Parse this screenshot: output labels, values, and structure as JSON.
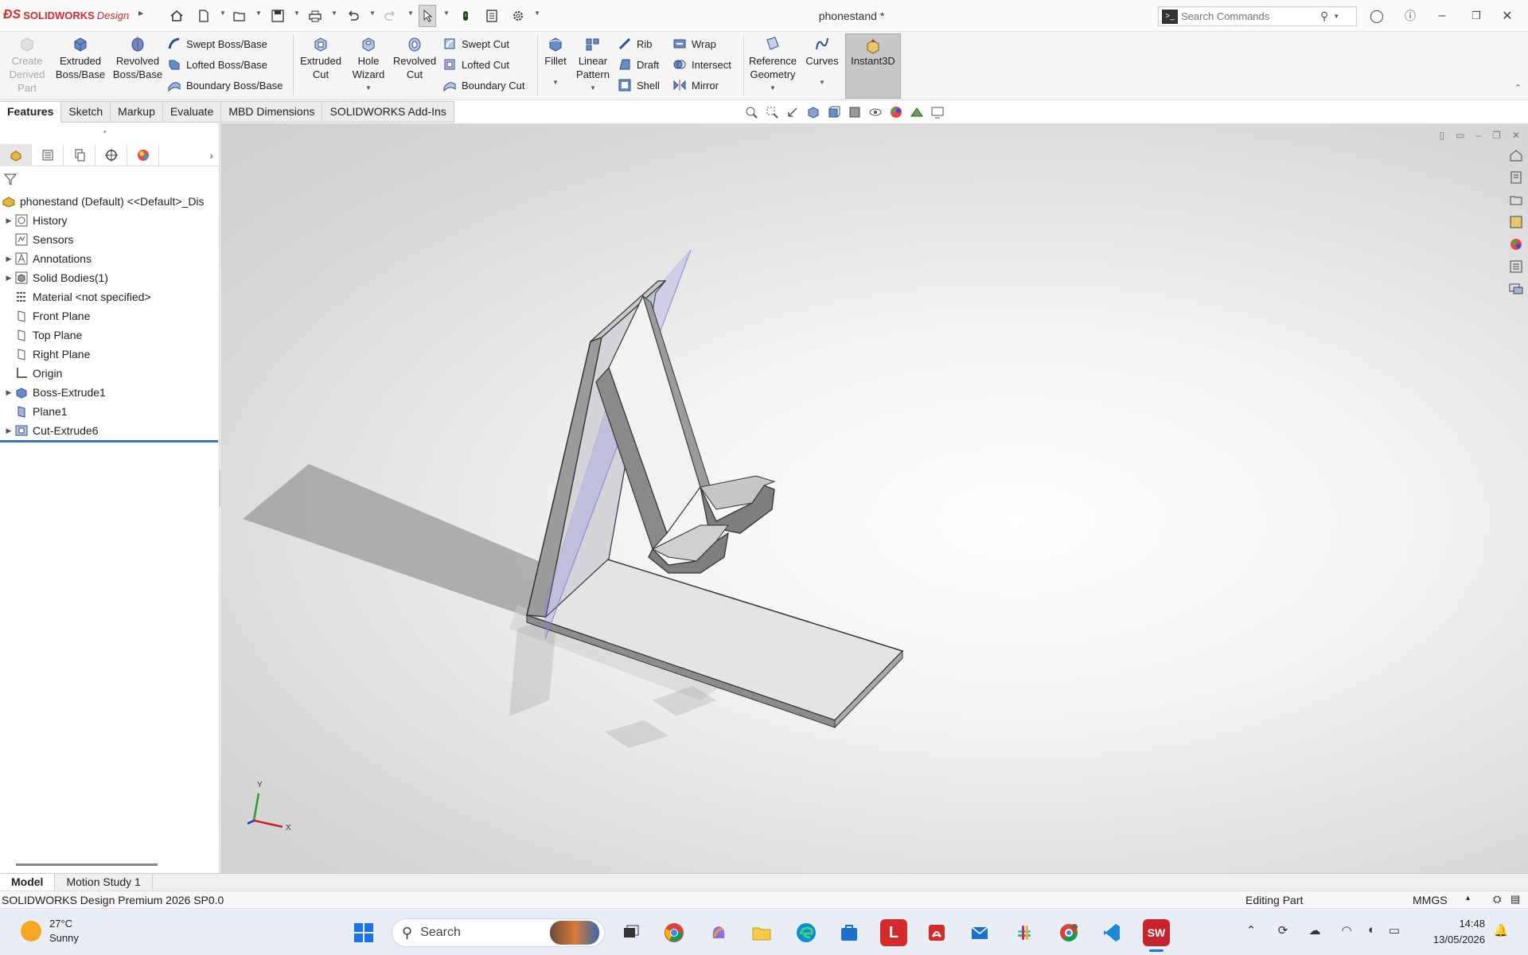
{
  "app": {
    "brand": "SOLIDWORKS",
    "brand_suffix": "Design",
    "doc_title": "phonestand *",
    "search_placeholder": "Search Commands"
  },
  "ribbon": {
    "create_derived": "Create Derived Part",
    "extruded_boss": "Extruded Boss/Base",
    "revolved_boss": "Revolved Boss/Base",
    "swept_boss": "Swept Boss/Base",
    "lofted_boss": "Lofted Boss/Base",
    "boundary_boss": "Boundary Boss/Base",
    "extruded_cut": "Extruded Cut",
    "hole_wizard": "Hole Wizard",
    "revolved_cut": "Revolved Cut",
    "swept_cut": "Swept Cut",
    "lofted_cut": "Lofted Cut",
    "boundary_cut": "Boundary Cut",
    "fillet": "Fillet",
    "linear_pattern": "Linear Pattern",
    "rib": "Rib",
    "draft": "Draft",
    "shell": "Shell",
    "wrap": "Wrap",
    "intersect": "Intersect",
    "mirror": "Mirror",
    "reference_geometry": "Reference Geometry",
    "curves": "Curves",
    "instant3d": "Instant3D"
  },
  "tabs": [
    "Features",
    "Sketch",
    "Markup",
    "Evaluate",
    "MBD Dimensions",
    "SOLIDWORKS Add-Ins"
  ],
  "tree": {
    "root": "phonestand (Default) <<Default>_Dis",
    "items": [
      {
        "label": "History",
        "expandable": true
      },
      {
        "label": "Sensors",
        "expandable": false
      },
      {
        "label": "Annotations",
        "expandable": true
      },
      {
        "label": "Solid Bodies(1)",
        "expandable": true
      },
      {
        "label": "Material <not specified>",
        "expandable": false
      },
      {
        "label": "Front Plane",
        "expandable": false
      },
      {
        "label": "Top Plane",
        "expandable": false
      },
      {
        "label": "Right Plane",
        "expandable": false
      },
      {
        "label": "Origin",
        "expandable": false
      },
      {
        "label": "Boss-Extrude1",
        "expandable": true
      },
      {
        "label": "Plane1",
        "expandable": false
      },
      {
        "label": "Cut-Extrude6",
        "expandable": true
      }
    ]
  },
  "triad": {
    "y": "Y",
    "x": "X"
  },
  "bottom_tabs": [
    "Model",
    "Motion Study 1"
  ],
  "status": {
    "version": "SOLIDWORKS Design Premium 2026 SP0.0",
    "mode": "Editing Part",
    "units": "MMGS"
  },
  "taskbar": {
    "temp": "27°C",
    "weather": "Sunny",
    "search": "Search",
    "time": "14:48",
    "date": "13/05/2026"
  },
  "colors": {
    "brand_red": "#d52b2b",
    "rollback_blue": "#3a73c4",
    "plane_blue": "#8c8ce6"
  }
}
